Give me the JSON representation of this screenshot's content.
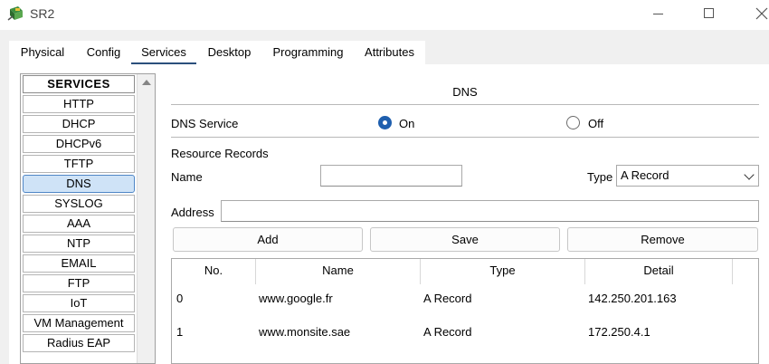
{
  "window": {
    "title": "SR2",
    "minimize_glyph": "—",
    "maximize_glyph": "☐",
    "close_glyph": "✕"
  },
  "tabs": [
    {
      "label": "Physical"
    },
    {
      "label": "Config"
    },
    {
      "label": "Services"
    },
    {
      "label": "Desktop"
    },
    {
      "label": "Programming"
    },
    {
      "label": "Attributes"
    }
  ],
  "services": {
    "header": "SERVICES",
    "items": [
      "HTTP",
      "DHCP",
      "DHCPv6",
      "TFTP",
      "DNS",
      "SYSLOG",
      "AAA",
      "NTP",
      "EMAIL",
      "FTP",
      "IoT",
      "VM Management",
      "Radius EAP"
    ],
    "active": "DNS"
  },
  "dns": {
    "title": "DNS",
    "service_label": "DNS Service",
    "on_label": "On",
    "off_label": "Off",
    "service_state": "On",
    "resource_records_label": "Resource Records",
    "name_label": "Name",
    "name_value": "",
    "type_label": "Type",
    "type_value": "A Record",
    "address_label": "Address",
    "address_value": "",
    "add_label": "Add",
    "save_label": "Save",
    "remove_label": "Remove",
    "table": {
      "columns": [
        "No.",
        "Name",
        "Type",
        "Detail"
      ],
      "rows": [
        {
          "no": "0",
          "name": "www.google.fr",
          "type": "A Record",
          "detail": "142.250.201.163"
        },
        {
          "no": "1",
          "name": "www.monsite.sae",
          "type": "A Record",
          "detail": "172.250.4.1"
        }
      ]
    }
  },
  "colors": {
    "accent": "#1f5fae",
    "active_service_bg": "#cfe3f7",
    "tab_underline": "#2b4f7c"
  }
}
